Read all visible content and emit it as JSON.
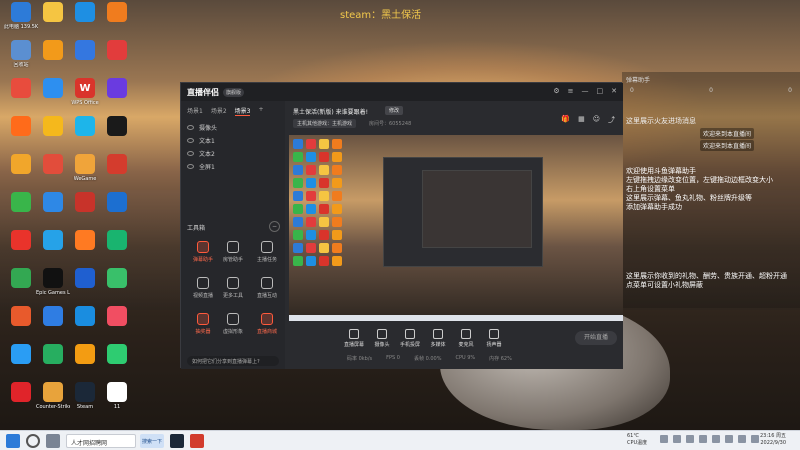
{
  "overlay_title": "steam：黑土保活",
  "desktop_icons": [
    {
      "label": "此电脑 139.5K",
      "letter": "",
      "color": "#2d7bd8"
    },
    {
      "label": "",
      "letter": "",
      "color": "#f5c542"
    },
    {
      "label": "",
      "letter": "",
      "color": "#1e8fe3"
    },
    {
      "label": "",
      "letter": "",
      "color": "#f07c1e"
    },
    {
      "label": "回收站",
      "letter": "",
      "color": "#5b8fd1"
    },
    {
      "label": "",
      "letter": "",
      "color": "#f29a1a"
    },
    {
      "label": "",
      "letter": "",
      "color": "#3477e0"
    },
    {
      "label": "",
      "letter": "",
      "color": "#e23c3c"
    },
    {
      "label": "",
      "letter": "",
      "color": "#e84c3d"
    },
    {
      "label": "",
      "letter": "",
      "color": "#2d8ff0"
    },
    {
      "label": "WPS Office",
      "letter": "W",
      "color": "#d9342b"
    },
    {
      "label": "",
      "letter": "",
      "color": "#6a3be0"
    },
    {
      "label": "",
      "letter": "",
      "color": "#ff6b1a"
    },
    {
      "label": "",
      "letter": "",
      "color": "#f5b81c"
    },
    {
      "label": "",
      "letter": "",
      "color": "#1db5ea"
    },
    {
      "label": "",
      "letter": "",
      "color": "#1a1a1a"
    },
    {
      "label": "",
      "letter": "",
      "color": "#f1a62b"
    },
    {
      "label": "",
      "letter": "",
      "color": "#e24d3b"
    },
    {
      "label": "WeGame",
      "letter": "",
      "color": "#f0a43a"
    },
    {
      "label": "",
      "letter": "",
      "color": "#d43c2d"
    },
    {
      "label": "",
      "letter": "",
      "color": "#39b54a"
    },
    {
      "label": "",
      "letter": "",
      "color": "#2e88e6"
    },
    {
      "label": "",
      "letter": "",
      "color": "#c8332a"
    },
    {
      "label": "",
      "letter": "",
      "color": "#1c6fd1"
    },
    {
      "label": "",
      "letter": "",
      "color": "#e9332b"
    },
    {
      "label": "",
      "letter": "",
      "color": "#26a2e8"
    },
    {
      "label": "",
      "letter": "",
      "color": "#ff7a22"
    },
    {
      "label": "",
      "letter": "",
      "color": "#19b46f"
    },
    {
      "label": "",
      "letter": "",
      "color": "#33a852"
    },
    {
      "label": "Epic Games Launcher",
      "letter": "",
      "color": "#111111"
    },
    {
      "label": "",
      "letter": "",
      "color": "#1f5fd0"
    },
    {
      "label": "",
      "letter": "",
      "color": "#39c06a"
    },
    {
      "label": "",
      "letter": "",
      "color": "#e85a2c"
    },
    {
      "label": "",
      "letter": "",
      "color": "#2f7de3"
    },
    {
      "label": "",
      "letter": "",
      "color": "#1a8de0"
    },
    {
      "label": "",
      "letter": "",
      "color": "#f14e62"
    },
    {
      "label": "",
      "letter": "",
      "color": "#2a9df4"
    },
    {
      "label": "",
      "letter": "",
      "color": "#27ae60"
    },
    {
      "label": "",
      "letter": "",
      "color": "#f39c12"
    },
    {
      "label": "",
      "letter": "",
      "color": "#2ecc71"
    },
    {
      "label": "",
      "letter": "",
      "color": "#e0242a"
    },
    {
      "label": "Counter-Strike Global Off...",
      "letter": "",
      "color": "#e8a33b"
    },
    {
      "label": "Steam",
      "letter": "",
      "color": "#1b2838"
    },
    {
      "label": "11",
      "letter": "",
      "color": "#ffffff"
    }
  ],
  "chat": {
    "header": "弹幕助手",
    "stats": [
      "0",
      "0",
      "0"
    ],
    "system_msg": "这里展示火友进场消息",
    "welcome1": "欢迎来到本直播间",
    "welcome2": "欢迎来到本直播间",
    "help_lines": [
      "欢迎使用斗鱼弹幕助手",
      "左键拖拽边缘改变位置，左键拖动边框改变大小",
      "右上角设置菜单",
      "这里展示弹幕、鱼丸礼物、粉丝牌升级等",
      "添加弹幕助手成功"
    ],
    "help2_lines": [
      "这里展示你收到的礼物、酬劳、贵族开通、超粉开通",
      "点菜单可设置小礼物屏蔽"
    ]
  },
  "app": {
    "logo": "直播伴侣",
    "version": "旗舰版",
    "scene_tabs": [
      "场景1",
      "场景2",
      "场景3"
    ],
    "active_scene": 2,
    "sources": [
      "摄像头",
      "文本1",
      "文本2",
      "全屏1"
    ],
    "tools_title": "工具箱",
    "tools": [
      {
        "label": "弹幕助手",
        "hot": true
      },
      {
        "label": "房管助手",
        "hot": false
      },
      {
        "label": "主播任务",
        "hot": false
      },
      {
        "label": "视频直播",
        "hot": false
      },
      {
        "label": "更多工具",
        "hot": false
      },
      {
        "label": "直播互动",
        "hot": false
      },
      {
        "label": "抽奖器",
        "hot": true
      },
      {
        "label": "虚拟形象",
        "hot": false
      },
      {
        "label": "直播商城",
        "hot": true
      }
    ],
    "ad_text": "如何把它们分享到直播弹幕上?",
    "room_title": "黑土保活(新版) 来谁要跟着!",
    "room_edit": "修改",
    "room_category": "主机其他游戏：主机游戏",
    "room_id": "房间号：6055248",
    "bottom_items": [
      "直播屏幕",
      "摄像头",
      "手机投屏",
      "多媒体",
      "麦克风",
      "扬声器"
    ],
    "start_live": "开始直播",
    "status_items": [
      "码率 0kb/s",
      "FPS 0",
      "丢帧 0.00%",
      "CPU 9%",
      "内存 62%"
    ]
  },
  "taskbar": {
    "search_text": "人才网招聘网",
    "active_btn": "搜索一下",
    "weather_temp": "61℃",
    "weather_text": "CPU温度",
    "time": "23:16 周五",
    "date": "2022/9/30"
  }
}
